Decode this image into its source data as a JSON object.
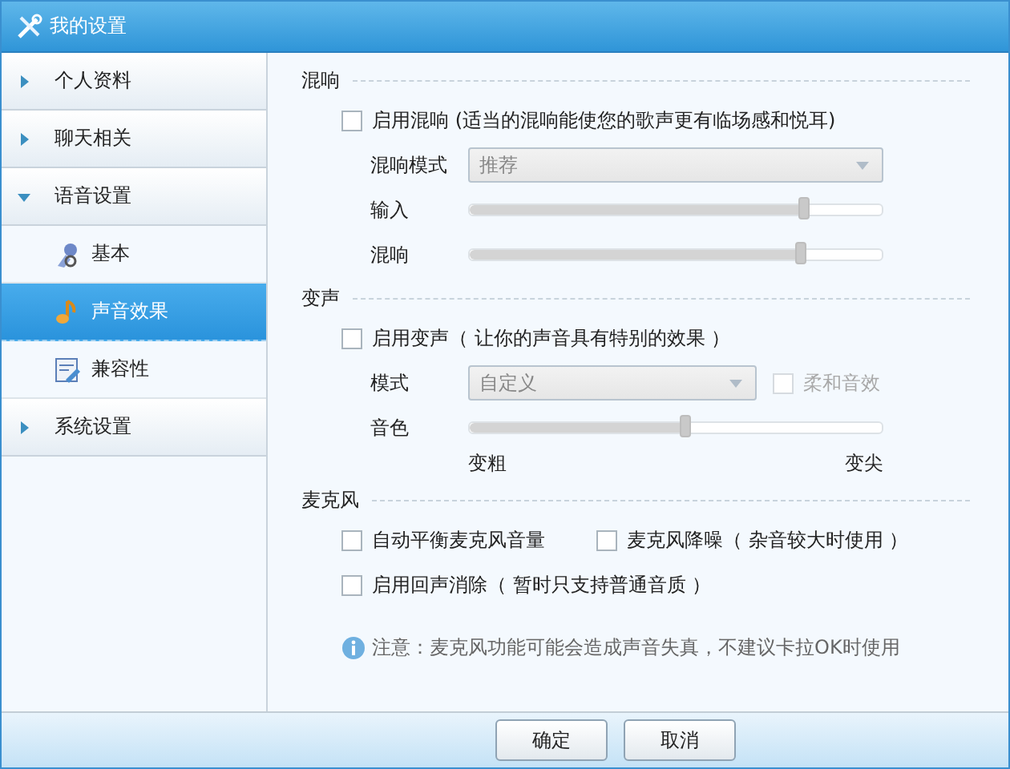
{
  "window": {
    "title": "我的设置"
  },
  "sidebar": {
    "items": [
      {
        "label": "个人资料",
        "kind": "group",
        "expanded": false,
        "selected": false
      },
      {
        "label": "聊天相关",
        "kind": "group",
        "expanded": false,
        "selected": false
      },
      {
        "label": "语音设置",
        "kind": "group",
        "expanded": true,
        "selected": false,
        "children": [
          {
            "label": "基本",
            "kind": "page",
            "selected": false
          },
          {
            "label": "声音效果",
            "kind": "page",
            "selected": true
          },
          {
            "label": "兼容性",
            "kind": "page",
            "selected": false
          }
        ]
      },
      {
        "label": "系统设置",
        "kind": "group",
        "expanded": false,
        "selected": false
      }
    ]
  },
  "sections": [
    {
      "title": "混响",
      "rows": [
        {
          "kind": "checks",
          "items": [
            {
              "label": "启用混响 (适当的混响能使您的歌声更有临场感和悦耳)",
              "checked": false
            }
          ]
        },
        {
          "kind": "dropdown",
          "label": "混响模式",
          "value": "推荐",
          "disabled": true
        },
        {
          "kind": "slider",
          "label": "输入",
          "level": 0.81,
          "disabled": true
        },
        {
          "kind": "slider",
          "label": "混响",
          "level": 0.8,
          "disabled": true
        }
      ]
    },
    {
      "title": "变声",
      "rows": [
        {
          "kind": "checks",
          "items": [
            {
              "label": "启用变声（ 让你的声音具有特别的效果 ）",
              "checked": false
            }
          ]
        },
        {
          "kind": "dropdown",
          "label": "模式",
          "value": "自定义",
          "disabled": true,
          "option": {
            "label": "柔和音效",
            "checked": false,
            "disabled": true
          }
        },
        {
          "kind": "slider",
          "label": "音色",
          "level": 0.52,
          "disabled": true,
          "min_label": "变粗",
          "max_label": "变尖"
        }
      ]
    },
    {
      "title": "麦克风",
      "rows": [
        {
          "kind": "checks",
          "items": [
            {
              "label": "自动平衡麦克风音量",
              "checked": false
            },
            {
              "label": "麦克风降噪（ 杂音较大时使用 ）",
              "checked": false
            }
          ]
        },
        {
          "kind": "checks",
          "items": [
            {
              "label": "启用回声消除（ 暂时只支持普通音质 ）",
              "checked": false
            }
          ]
        },
        {
          "kind": "note",
          "text": "注意：麦克风功能可能会造成声音失真，不建议卡拉OK时使用"
        }
      ]
    }
  ],
  "buttons": [
    {
      "label": "确定"
    },
    {
      "label": "取消"
    }
  ]
}
